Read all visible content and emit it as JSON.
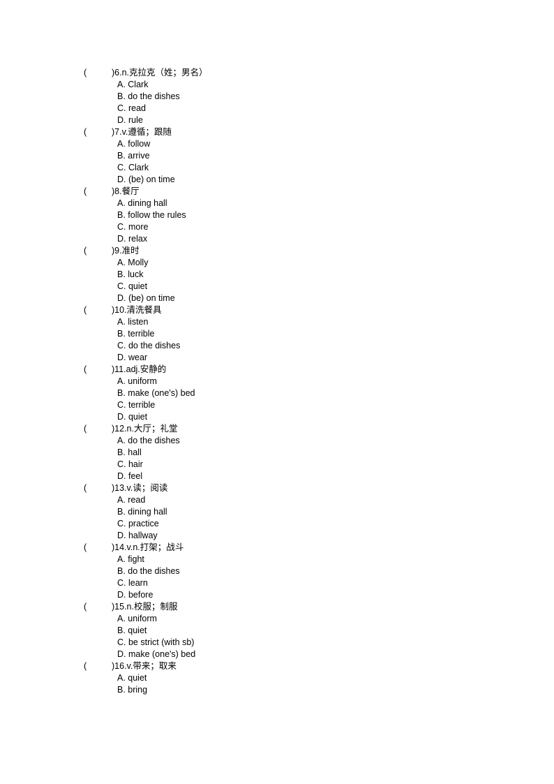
{
  "document": {
    "type": "vocabulary-matching-worksheet",
    "text_color": "#000000",
    "background_color": "#ffffff",
    "bracket_open": "(",
    "bracket_close": ")"
  },
  "questions": [
    {
      "number": "6",
      "stem": ")6.n.克拉克（姓；男名）",
      "options": [
        "A. Clark",
        "B. do the dishes",
        "C. read",
        "D. rule"
      ]
    },
    {
      "number": "7",
      "stem": ")7.v.遵循；跟随",
      "options": [
        "A. follow",
        "B. arrive",
        "C. Clark",
        "D. (be) on time"
      ]
    },
    {
      "number": "8",
      "stem": ")8.餐厅",
      "options": [
        "A. dining hall",
        "B. follow the rules",
        "C. more",
        "D. relax"
      ]
    },
    {
      "number": "9",
      "stem": ")9.准时",
      "options": [
        "A. Molly",
        "B. luck",
        "C. quiet",
        "D. (be) on time"
      ]
    },
    {
      "number": "10",
      "stem": ")10.清洗餐具",
      "options": [
        "A. listen",
        "B. terrible",
        "C. do the dishes",
        "D. wear"
      ]
    },
    {
      "number": "11",
      "stem": ")11.adj.安静的",
      "options": [
        "A. uniform",
        "B. make (one's) bed",
        "C. terrible",
        "D. quiet"
      ]
    },
    {
      "number": "12",
      "stem": ")12.n.大厅；礼堂",
      "options": [
        "A. do the dishes",
        "B. hall",
        "C. hair",
        "D. feel"
      ]
    },
    {
      "number": "13",
      "stem": ")13.v.读；阅读",
      "options": [
        "A. read",
        "B. dining hall",
        "C. practice",
        "D. hallway"
      ]
    },
    {
      "number": "14",
      "stem": ")14.v.n.打架；战斗",
      "options": [
        "A. fight",
        "B. do the dishes",
        "C. learn",
        "D. before"
      ]
    },
    {
      "number": "15",
      "stem": ")15.n.校服；制服",
      "options": [
        "A. uniform",
        "B. quiet",
        "C. be strict (with sb)",
        "D. make (one's) bed"
      ]
    },
    {
      "number": "16",
      "stem": ")16.v.带来；取来",
      "options": [
        "A. quiet",
        "B. bring"
      ]
    }
  ]
}
